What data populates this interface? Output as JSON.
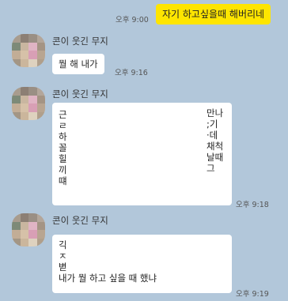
{
  "chat": {
    "my_message": {
      "text": "자기 하고싶을때 해버리네",
      "time": "오후 9:00"
    },
    "sender": "콘이 웃긴 무지",
    "messages": [
      {
        "lines": [
          "뭘 해 내가"
        ],
        "time": "오후 9:16"
      },
      {
        "left_lines": [
          "근",
          "ㄹ",
          "하",
          "꼴",
          "힐",
          "끼",
          "떄"
        ],
        "right_lines": [
          "만나",
          ";기",
          "·데",
          "채척",
          "날때",
          "그"
        ],
        "time": "오후 9:18"
      },
      {
        "fragment_lines": [
          "긱",
          "ㅈ",
          "볃"
        ],
        "last_line": "내가 뭘 하고 싶을 때 했냐",
        "time": "오후 9:19"
      }
    ]
  }
}
